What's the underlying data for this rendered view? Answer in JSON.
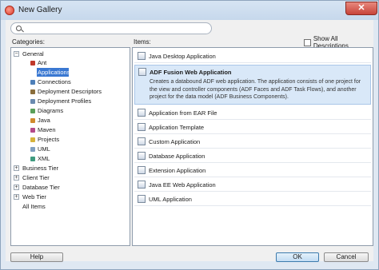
{
  "window": {
    "title": "New Gallery",
    "close_glyph": "✕"
  },
  "search": {
    "placeholder": ""
  },
  "categories": {
    "label": "Categories:",
    "tree": [
      {
        "label": "General",
        "toggle": "−"
      },
      {
        "label": "Ant"
      },
      {
        "label": "Applications",
        "selected": true
      },
      {
        "label": "Connections"
      },
      {
        "label": "Deployment Descriptors"
      },
      {
        "label": "Deployment Profiles"
      },
      {
        "label": "Diagrams"
      },
      {
        "label": "Java"
      },
      {
        "label": "Maven"
      },
      {
        "label": "Projects"
      },
      {
        "label": "UML"
      },
      {
        "label": "XML"
      },
      {
        "label": "Business Tier",
        "toggle": "+"
      },
      {
        "label": "Client Tier",
        "toggle": "+"
      },
      {
        "label": "Database Tier",
        "toggle": "+"
      },
      {
        "label": "Web Tier",
        "toggle": "+"
      },
      {
        "label": "All Items"
      }
    ]
  },
  "items": {
    "label": "Items:",
    "show_all": "Show All Descriptions",
    "list": [
      {
        "label": "Java Desktop Application",
        "icon": "java-app-icon"
      },
      {
        "label": "ADF Fusion Web Application",
        "icon": "adf-app-icon",
        "description": "Creates a databound ADF web application. The application consists of one project for the view and controller components (ADF Faces and ADF Task Flows), and another project for the data model (ADF Business Components)."
      },
      {
        "label": "Application from EAR File",
        "icon": "ear-file-icon"
      },
      {
        "label": "Application Template",
        "icon": "template-icon"
      },
      {
        "label": "Custom Application",
        "icon": "custom-app-icon"
      },
      {
        "label": "Database Application",
        "icon": "database-app-icon"
      },
      {
        "label": "Extension Application",
        "icon": "extension-app-icon"
      },
      {
        "label": "Java EE Web Application",
        "icon": "javaee-app-icon"
      },
      {
        "label": "UML Application",
        "icon": "uml-app-icon"
      }
    ]
  },
  "buttons": {
    "help": "Help",
    "ok": "OK",
    "cancel": "Cancel"
  }
}
